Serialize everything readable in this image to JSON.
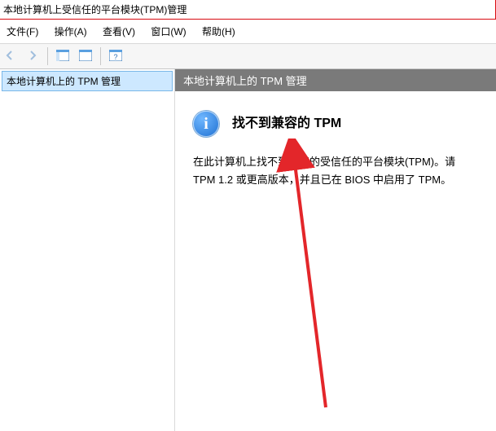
{
  "titlebar": {
    "title": "本地计算机上受信任的平台模块(TPM)管理"
  },
  "menubar": {
    "file": "文件(F)",
    "action": "操作(A)",
    "view": "查看(V)",
    "window": "窗口(W)",
    "help": "帮助(H)"
  },
  "tree": {
    "root_label": "本地计算机上的 TPM 管理"
  },
  "pane": {
    "header": "本地计算机上的 TPM 管理",
    "heading": "找不到兼容的 TPM",
    "info_glyph": "i",
    "body_line1": "在此计算机上找不到兼容的受信任的平台模块(TPM)。请",
    "body_line2": "TPM 1.2 或更高版本，并且已在 BIOS 中启用了 TPM。"
  }
}
